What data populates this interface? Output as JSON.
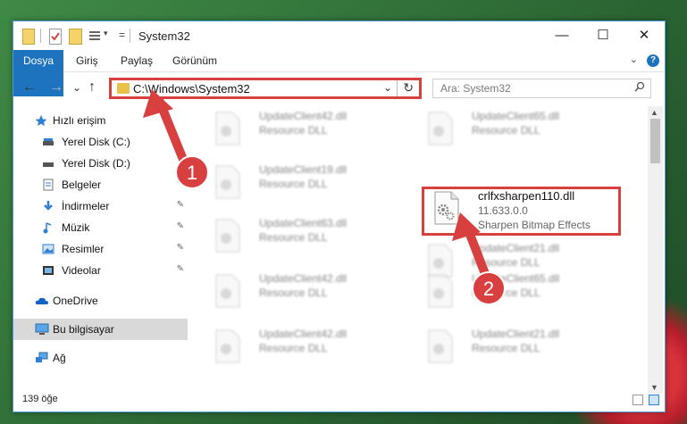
{
  "window": {
    "title": "System32",
    "controls": {
      "minimize": "—",
      "maximize": "☐",
      "close": "✕"
    }
  },
  "ribbon": {
    "tabs": [
      "Dosya",
      "Giriş",
      "Paylaş",
      "Görünüm"
    ],
    "help": "?",
    "expand": "⌄"
  },
  "address": {
    "path": "C:\\Windows\\System32",
    "dropdown": "⌄",
    "refresh": "↻"
  },
  "search": {
    "placeholder": "Ara: System32"
  },
  "nav_buttons": {
    "back": "←",
    "forward": "→",
    "recent": "⌄",
    "up": "↑"
  },
  "sidebar": {
    "items": [
      {
        "label": "Hızlı erişim",
        "icon": "star-icon"
      },
      {
        "label": "Yerel Disk (C:)",
        "icon": "drive-icon"
      },
      {
        "label": "Yerel Disk (D:)",
        "icon": "drive-icon"
      },
      {
        "label": "Belgeler",
        "icon": "documents-icon",
        "pinned": true
      },
      {
        "label": "İndirmeler",
        "icon": "downloads-icon",
        "pinned": true
      },
      {
        "label": "Müzik",
        "icon": "music-icon",
        "pinned": true
      },
      {
        "label": "Resimler",
        "icon": "pictures-icon",
        "pinned": true
      },
      {
        "label": "Videolar",
        "icon": "videos-icon",
        "pinned": true
      },
      {
        "label": "OneDrive",
        "icon": "onedrive-icon"
      },
      {
        "label": "Bu bilgisayar",
        "icon": "computer-icon",
        "selected": true
      },
      {
        "label": "Ağ",
        "icon": "network-icon"
      }
    ],
    "pin_glyph": "📌"
  },
  "files": [
    {
      "name": "UpdateClient42.dll",
      "type": "Resource DLL"
    },
    {
      "name": "UpdateClient65.dll",
      "type": "Resource DLL"
    },
    {
      "name": "UpdateClient19.dll",
      "type": "Resource DLL"
    },
    {
      "name": "crlfxsharpen110.dll",
      "version": "11.633.0.0",
      "type": "Sharpen Bitmap Effects",
      "highlighted": true
    },
    {
      "name": "UpdateClient63.dll",
      "type": "Resource DLL"
    },
    {
      "name": "UpdateClient21.dll",
      "type": "Resource DLL"
    },
    {
      "name": "UpdateClient42.dll",
      "type": "Resource DLL"
    },
    {
      "name": "UpdateClient65.dll",
      "type": "Resource DLL"
    },
    {
      "name": "UpdateClient42.dll",
      "type": "Resource DLL"
    },
    {
      "name": "UpdateClient21.dll",
      "type": "Resource DLL"
    }
  ],
  "annotations": {
    "step1": "1",
    "step2": "2"
  },
  "status": {
    "count": "139 öğe"
  },
  "colors": {
    "accent": "#1e73be",
    "highlight": "#d84040",
    "badge": "#d84040"
  }
}
